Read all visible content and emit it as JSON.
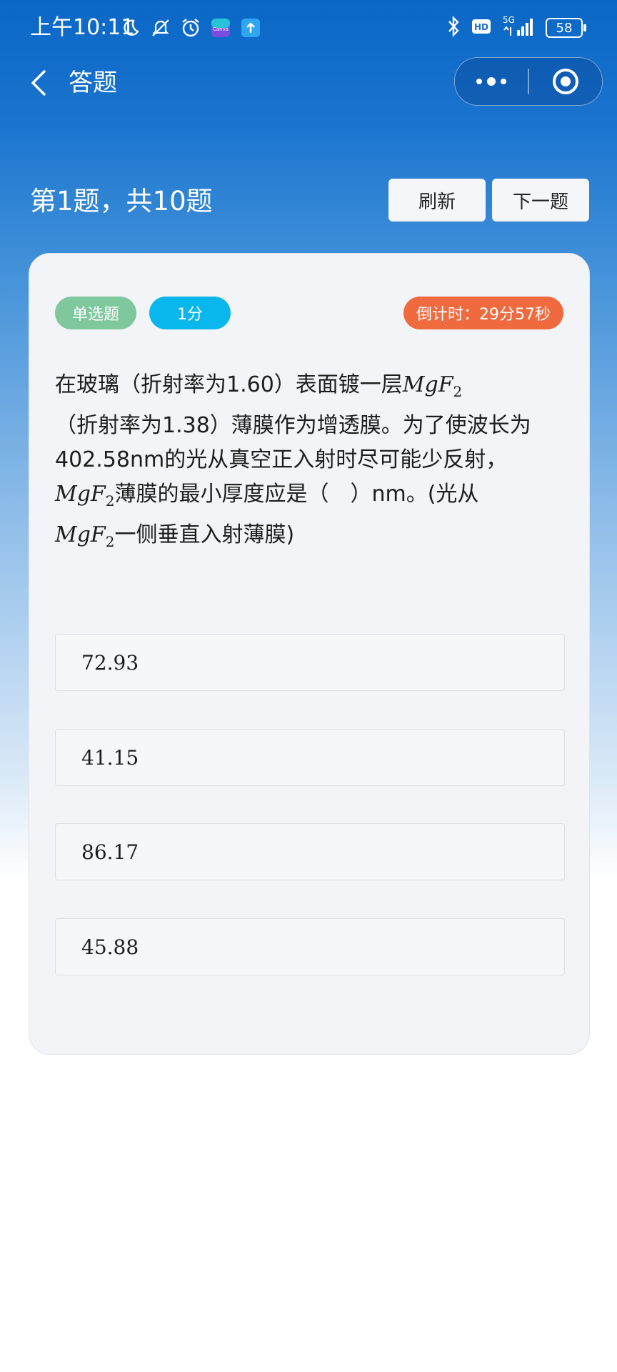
{
  "status_bar": {
    "time": "上午10:11",
    "battery": "58",
    "network": "5G",
    "hd": "HD",
    "icons_left": [
      "moon-icon",
      "mute-icon",
      "alarm-icon",
      "canva-app-icon",
      "upload-app-icon"
    ],
    "icons_right": [
      "bluetooth-icon",
      "hd-icon",
      "signal-icon",
      "battery-icon"
    ]
  },
  "nav": {
    "title": "答题",
    "more_icon": "more-dots-icon",
    "close_icon": "target-icon"
  },
  "header": {
    "progress": "第1题，共10题",
    "refresh_label": "刷新",
    "next_label": "下一题"
  },
  "card": {
    "type_tag": "单选题",
    "score_tag": "1分",
    "timer": "倒计时：29分57秒",
    "question": {
      "part1": "在玻璃（折射率为1.60）表面镀一层",
      "math_base": "MgF",
      "math_sub": "2",
      "part2": "（折射率为1.38）薄膜作为增透膜。为了使波长为",
      "part3": "402.58nm的光从真空正入射时尽可能少反射，",
      "part4": "薄膜的最小厚度应是（　）nm。(光从",
      "part5": "一侧垂直入射薄膜)"
    },
    "options": [
      "72.93",
      "41.15",
      "86.17",
      "45.88"
    ]
  },
  "colors": {
    "top_blue": "#0a67c6",
    "tag_green": "#7fc79c",
    "tag_blue": "#0ab7ec",
    "tag_orange": "#ef6a3e"
  }
}
